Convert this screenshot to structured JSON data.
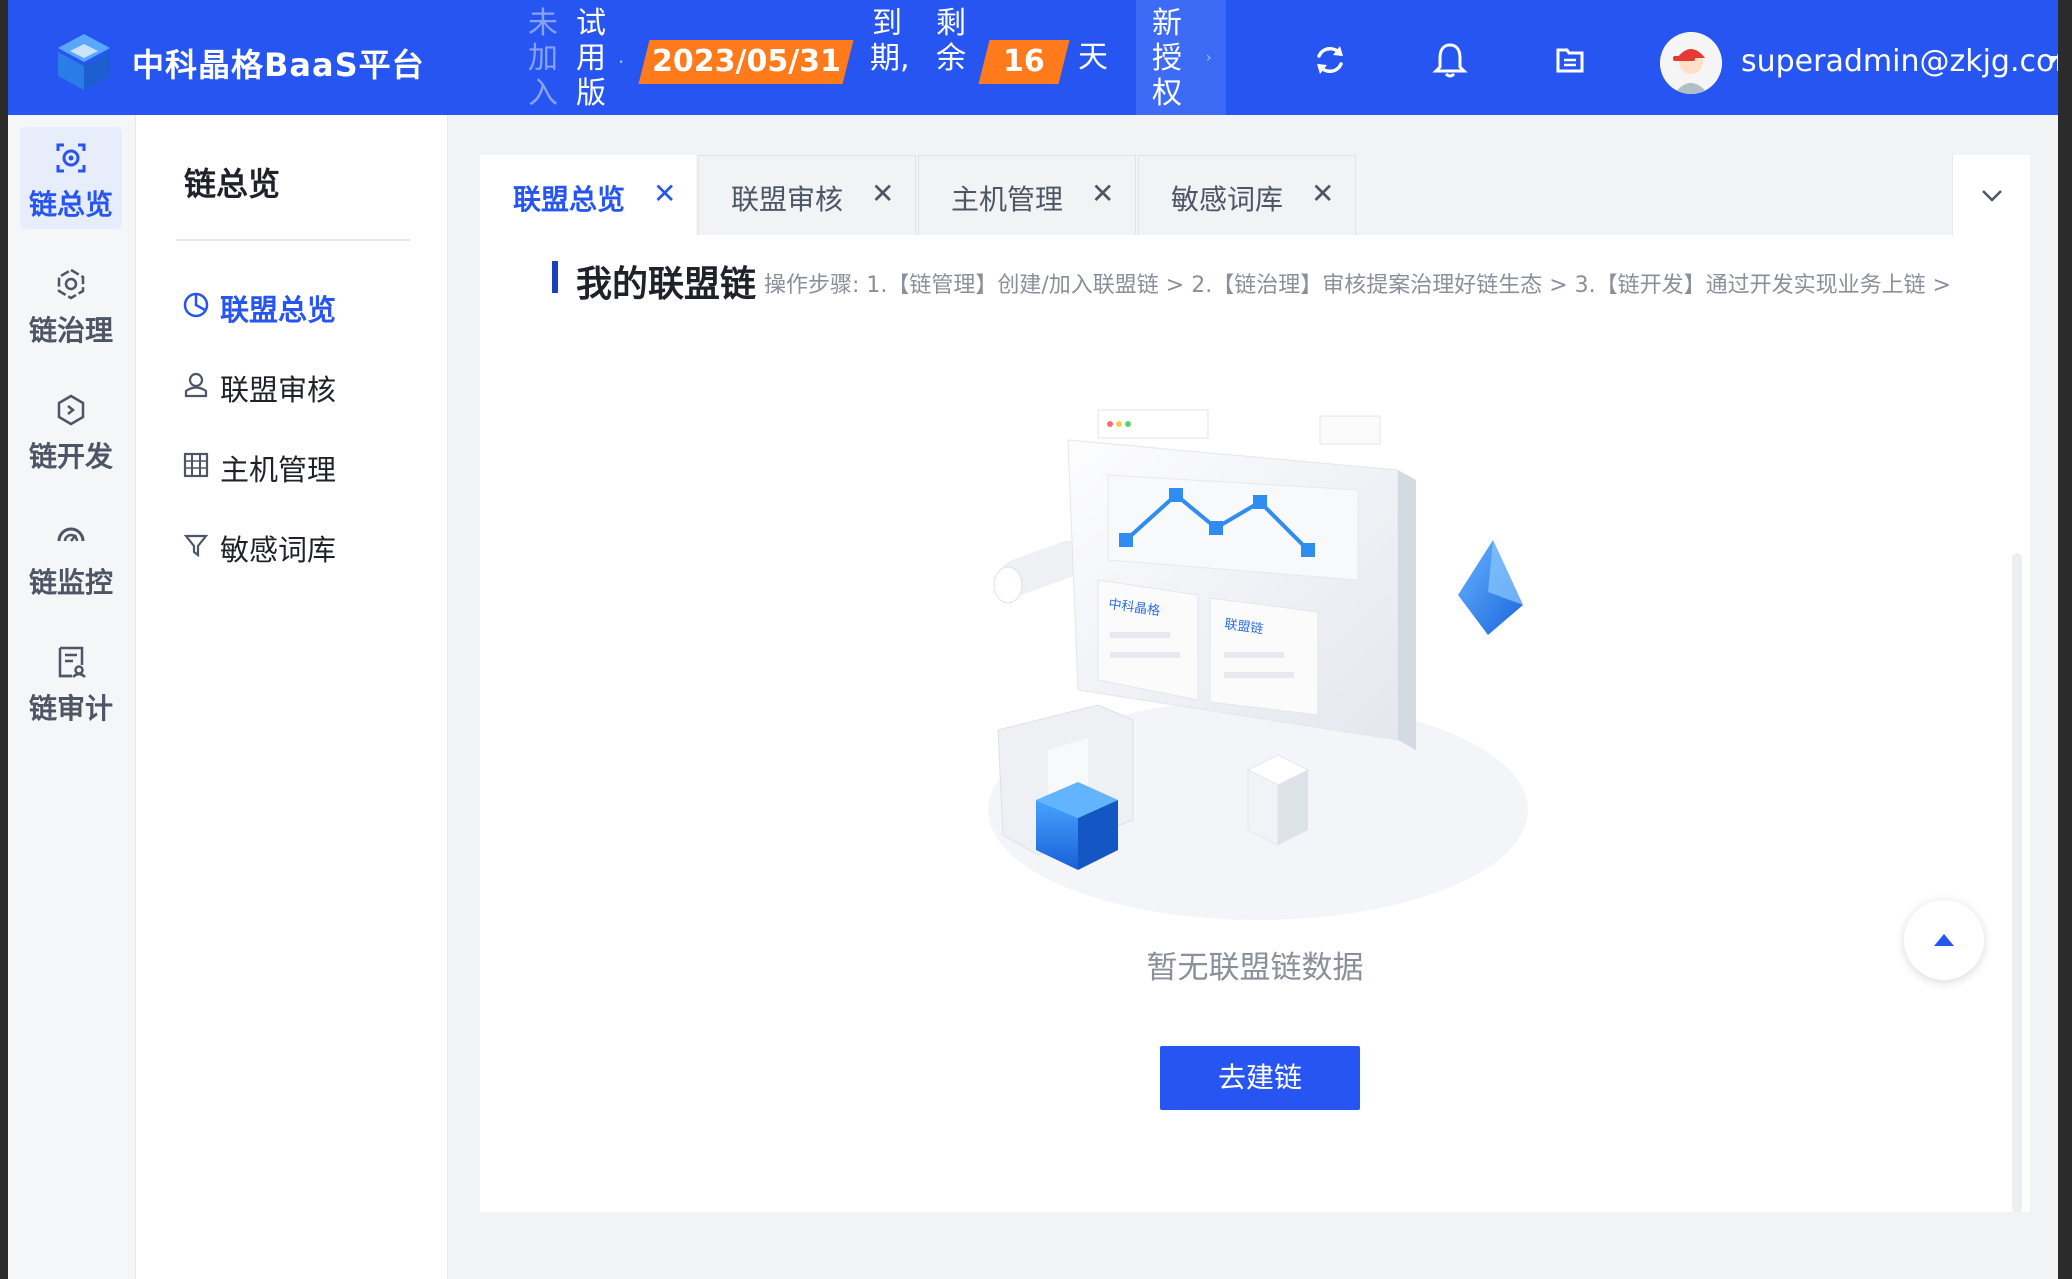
{
  "header": {
    "brand": "中科晶格BaaS平台",
    "joined_chars": "未加入",
    "trial_chars": "试用版",
    "expire_date": "2023/05/31",
    "expire_label": "到期,",
    "remaining_label": "剩余",
    "remaining_days": "16",
    "days_unit": "天",
    "new_auth": "新授权",
    "user_email": "superadmin@zkjg.com",
    "icons": [
      "logo-icon",
      "refresh-icon",
      "bell-icon",
      "folder-icon",
      "avatar",
      "caret-down-icon"
    ]
  },
  "rail": {
    "items": [
      {
        "label": "链总览",
        "icon": "overview-icon",
        "active": true
      },
      {
        "label": "链治理",
        "icon": "governance-icon",
        "active": false
      },
      {
        "label": "链开发",
        "icon": "develop-icon",
        "active": false
      },
      {
        "label": "链监控",
        "icon": "monitor-icon",
        "active": false
      },
      {
        "label": "链审计",
        "icon": "audit-icon",
        "active": false
      }
    ]
  },
  "submenu": {
    "title": "链总览",
    "items": [
      {
        "label": "联盟总览",
        "icon": "pie-chart-icon",
        "active": true
      },
      {
        "label": "联盟审核",
        "icon": "user-check-icon",
        "active": false
      },
      {
        "label": "主机管理",
        "icon": "server-icon",
        "active": false
      },
      {
        "label": "敏感词库",
        "icon": "filter-icon",
        "active": false
      }
    ]
  },
  "tabs": [
    {
      "label": "联盟总览",
      "active": true
    },
    {
      "label": "联盟审核",
      "active": false
    },
    {
      "label": "主机管理",
      "active": false
    },
    {
      "label": "敏感词库",
      "active": false
    }
  ],
  "tab_close_glyph": "✕",
  "main": {
    "section_title": "我的联盟链",
    "section_hint": "操作步骤: 1.【链管理】创建/加入联盟链 > 2.【链治理】审核提案治理好链生态 > 3.【链开发】通过开发实现业务上链 >",
    "illustration_labels": [
      "中科晶格",
      "联盟链"
    ],
    "empty_text": "暂无联盟链数据",
    "create_button": "去建链"
  },
  "colors": {
    "primary": "#2655f1",
    "accent_orange": "#ff7a1a"
  }
}
